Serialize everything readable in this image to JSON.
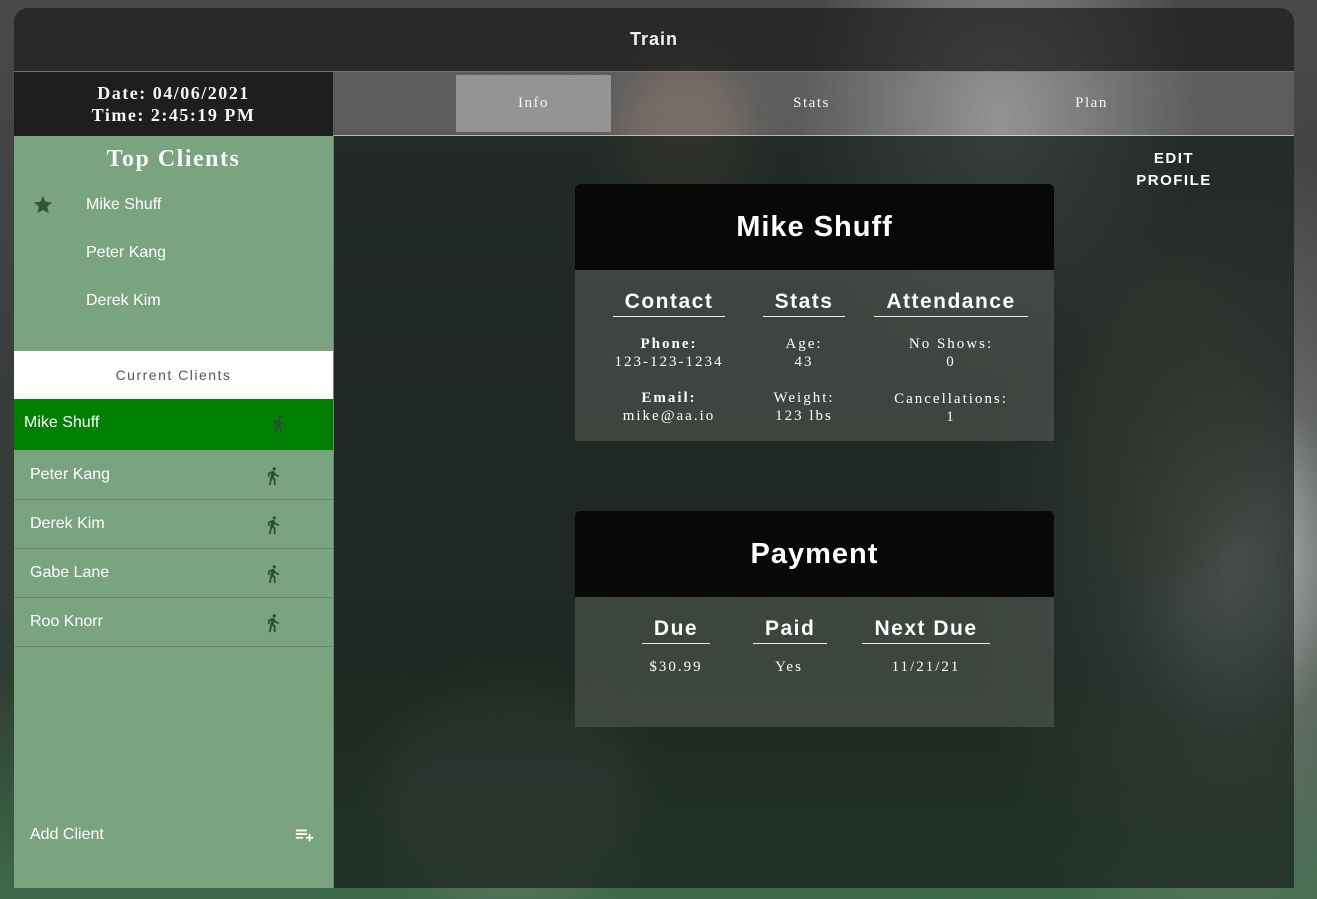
{
  "app": {
    "title": "Train"
  },
  "clock": {
    "date": "Date: 04/06/2021",
    "time": "Time: 2:45:19 PM"
  },
  "tabs": [
    {
      "label": "Info",
      "active": true
    },
    {
      "label": "Stats",
      "active": false
    },
    {
      "label": "Plan",
      "active": false
    }
  ],
  "sidebar": {
    "top_clients_title": "Top Clients",
    "top_clients": [
      "Mike Shuff",
      "Peter Kang",
      "Derek Kim"
    ],
    "current_clients_title": "Current Clients",
    "current_clients": [
      "Mike Shuff",
      "Peter Kang",
      "Derek Kim",
      "Gabe Lane",
      "Roo Knorr"
    ],
    "add_client_label": "Add Client",
    "icons": {
      "top": "star-icon",
      "client": "runner-icon",
      "add": "playlist-add-icon"
    }
  },
  "profile": {
    "edit_label_1": "EDIT",
    "edit_label_2": "PROFILE",
    "name": "Mike Shuff",
    "contact_title": "Contact",
    "phone_label": "Phone:",
    "phone": "123-123-1234",
    "email_label": "Email:",
    "email": "mike@aa.io",
    "stats_title": "Stats",
    "age_label": "Age:",
    "age": "43",
    "weight_label": "Weight:",
    "weight": "123 lbs",
    "attendance_title": "Attendance",
    "noshow_label": "No Shows:",
    "noshow": "0",
    "cancel_label": "Cancellations:",
    "cancel": "1"
  },
  "payment": {
    "title": "Payment",
    "due_title": "Due",
    "due": "$30.99",
    "paid_title": "Paid",
    "paid": "Yes",
    "next_title": "Next Due",
    "next": "11/21/21"
  },
  "colors": {
    "sidebar": "#7aa47f",
    "active_client": "#008000"
  }
}
